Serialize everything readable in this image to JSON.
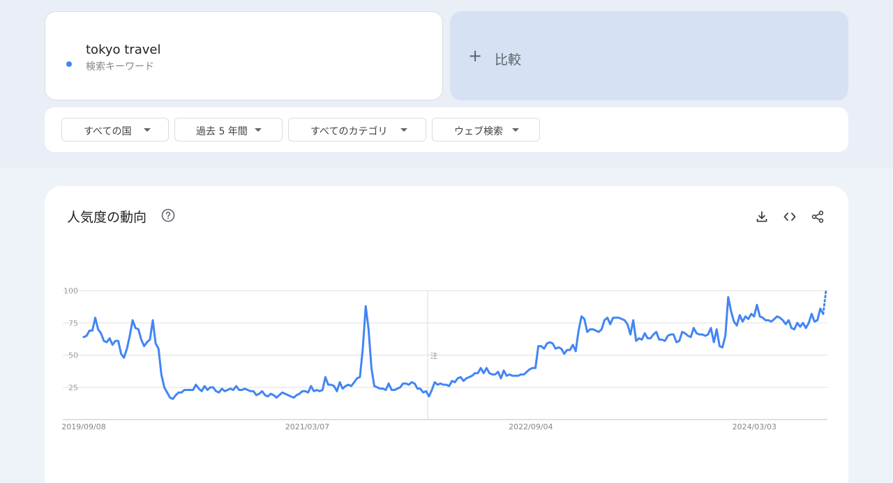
{
  "term": {
    "title": "tokyo travel",
    "subtitle": "検索キーワード",
    "color": "#4285f4"
  },
  "compare": {
    "label": "比較"
  },
  "filters": [
    {
      "label": "すべての国"
    },
    {
      "label": "過去 5 年間"
    },
    {
      "label": "すべてのカテゴリ"
    },
    {
      "label": "ウェブ検索"
    }
  ],
  "chart": {
    "title": "人気度の動向",
    "icons": [
      "help-icon",
      "download-icon",
      "embed-icon",
      "share-icon"
    ]
  },
  "chart_data": {
    "type": "line",
    "title": "人気度の動向",
    "xlabel": "",
    "ylabel": "",
    "ylim": [
      0,
      100
    ],
    "yticks": [
      25,
      50,
      75,
      100
    ],
    "x_tick_labels": [
      "2019/09/08",
      "2021/03/07",
      "2022/09/04",
      "2024/03/03"
    ],
    "x_start": "2019/09/08",
    "x_end": "2024/08/25",
    "annotation": "注",
    "annotation_date": "2021/12/26",
    "partial_last_point": true,
    "grid": true,
    "series": [
      {
        "color": "#4285f4",
        "values": [
          64,
          65,
          69,
          69,
          79,
          70,
          67,
          61,
          60,
          63,
          58,
          61,
          61,
          51,
          48,
          55,
          65,
          77,
          71,
          70,
          62,
          57,
          60,
          62,
          77,
          59,
          55,
          35,
          25,
          21,
          17,
          16,
          19,
          21,
          21,
          23,
          23,
          23,
          23,
          27,
          24,
          22,
          26,
          23,
          25,
          25,
          22,
          21,
          24,
          22,
          23,
          24,
          23,
          26,
          23,
          23,
          24,
          23,
          22,
          22,
          19,
          20,
          22,
          19,
          18,
          20,
          19,
          17,
          19,
          21,
          20,
          19,
          18,
          17,
          19,
          20,
          22,
          22,
          21,
          26,
          22,
          23,
          22,
          23,
          33,
          27,
          27,
          26,
          22,
          29,
          24,
          26,
          27,
          26,
          29,
          32,
          33,
          55,
          88,
          70,
          40,
          26,
          25,
          24,
          24,
          23,
          28,
          23,
          23,
          24,
          25,
          28,
          28,
          27,
          29,
          28,
          24,
          24,
          21,
          22,
          18,
          23,
          29,
          27,
          28,
          27,
          27,
          26,
          30,
          29,
          32,
          33,
          30,
          32,
          33,
          34,
          36,
          36,
          40,
          36,
          40,
          36,
          35,
          35,
          37,
          32,
          38,
          34,
          35,
          34,
          34,
          34,
          35,
          35,
          37,
          39,
          40,
          40,
          57,
          57,
          55,
          59,
          60,
          59,
          55,
          56,
          55,
          51,
          54,
          54,
          58,
          53,
          69,
          80,
          78,
          68,
          70,
          70,
          69,
          68,
          70,
          77,
          79,
          74,
          79,
          79,
          79,
          78,
          77,
          74,
          66,
          77,
          61,
          63,
          62,
          67,
          63,
          63,
          66,
          68,
          62,
          62,
          61,
          65,
          66,
          66,
          60,
          61,
          68,
          67,
          65,
          64,
          71,
          67,
          66,
          66,
          65,
          66,
          71,
          60,
          70,
          57,
          56,
          65,
          95,
          84,
          76,
          73,
          81,
          76,
          80,
          78,
          82,
          80,
          89,
          80,
          79,
          77,
          77,
          76,
          78,
          80,
          79,
          77,
          74,
          77,
          71,
          70,
          75,
          72,
          75,
          71,
          75,
          82,
          76,
          77,
          86,
          82,
          100
        ]
      }
    ]
  }
}
